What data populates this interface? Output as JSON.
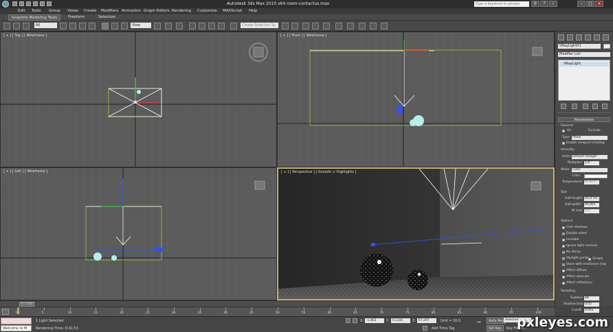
{
  "titlebar": {
    "title": "Autodesk 3ds Max 2010 x64      room-contactus.max",
    "search_placeholder": "Type a keyword or phrase"
  },
  "menus": [
    "Edit",
    "Tools",
    "Group",
    "Views",
    "Create",
    "Modifiers",
    "Animation",
    "Graph Editors",
    "Rendering",
    "Customize",
    "MAXScript",
    "Help"
  ],
  "ribbon_tabs": [
    "Graphite Modeling Tools",
    "Freeform",
    "Selection"
  ],
  "toolbar": {
    "filter_value": "All",
    "refcoord_value": "View",
    "named_selection_placeholder": "Create Selection Se"
  },
  "viewports": {
    "top": "[ + ] [ Top ] [ Wireframe ]",
    "front": "[ + ] [ Front ] [ Wireframe ]",
    "left": "[ + ] [ Left ] [ Wireframe ]",
    "perspective": "[ + ] [ Perspective ] [ Smooth + Highlights ]"
  },
  "command_panel": {
    "object_name": "VRayLight01",
    "modifier_list": "Modifier List",
    "stack_item": "VRayLight",
    "rollout_title": "Parameters",
    "general_label": "General",
    "on_label": "On",
    "exclude_label": "Exclude",
    "type_label": "Type:",
    "type_value": "Plane",
    "enable_viewport_shading": "Enable viewport shading",
    "intensity_label": "Intensity",
    "units_label": "Units:",
    "units_value": "Default (image)",
    "multiplier_label": "Multiplier:",
    "multiplier_value": "1,0",
    "mode_label": "Mode:",
    "mode_value": "Color",
    "color_label": "Color:",
    "temperature_label": "Temperature:",
    "temperature_value": "6500,0",
    "size_label": "Size",
    "half_length_label": "Half-length:",
    "half_length_value": "64,8 cm",
    "half_width_label": "Half-width:",
    "half_width_value": "46,461",
    "w_size_label": "W size:",
    "w_size_value": "1,0",
    "options_label": "Options",
    "options": [
      {
        "label": "Cast shadows",
        "checked": true
      },
      {
        "label": "Double-sided",
        "checked": false
      },
      {
        "label": "Invisible",
        "checked": true
      },
      {
        "label": "Ignore light normals",
        "checked": true
      },
      {
        "label": "No decay",
        "checked": false
      },
      {
        "label": "Skylight portal",
        "checked": false
      },
      {
        "label": "Store with irradiance map",
        "checked": false
      },
      {
        "label": "Affect diffuse",
        "checked": true
      },
      {
        "label": "Affect specular",
        "checked": true
      },
      {
        "label": "Affect reflections",
        "checked": true
      }
    ],
    "simple_label": "Simple",
    "sampling_label": "Sampling",
    "subdivs_label": "Subdivs:",
    "subdivs_value": "48",
    "shadow_bias_label": "Shadow bias:",
    "shadow_bias_value": "0,02",
    "cutoff_label": "Cutoff:",
    "cutoff_value": "0,001"
  },
  "timeline": {
    "slider_label": "0 / 100",
    "ticks": [
      "0",
      "5",
      "10",
      "15",
      "20",
      "25",
      "30",
      "35",
      "40",
      "45",
      "50",
      "55",
      "60",
      "65",
      "70",
      "75",
      "80",
      "85",
      "90",
      "95",
      "100"
    ]
  },
  "status": {
    "maxscript_text": "Welcome to M",
    "selection_status": "1 Light Selected",
    "rendering_time": "Rendering Time: 0:41:53",
    "x_label": "X:",
    "x_value": "-1,463",
    "y_label": "Y:",
    "y_value": "0,1181",
    "z_label": "Z:",
    "z_value": "67,297",
    "grid": "Grid = 10,0",
    "add_time_tag": "Add Time Tag",
    "auto_key": "Auto Key",
    "set_key": "Set Key",
    "selected_value": "Selected",
    "key_filters": "Key Filters..."
  },
  "watermark": "pxleyes.com",
  "colors": {
    "viewport_bg": "#5b5b5b",
    "grid": "#6b6b6b",
    "selection_yellow": "#c9b36b",
    "gizmo_green": "#3fbf3f",
    "gizmo_blue": "#3050ff",
    "gizmo_red": "#e03030"
  }
}
